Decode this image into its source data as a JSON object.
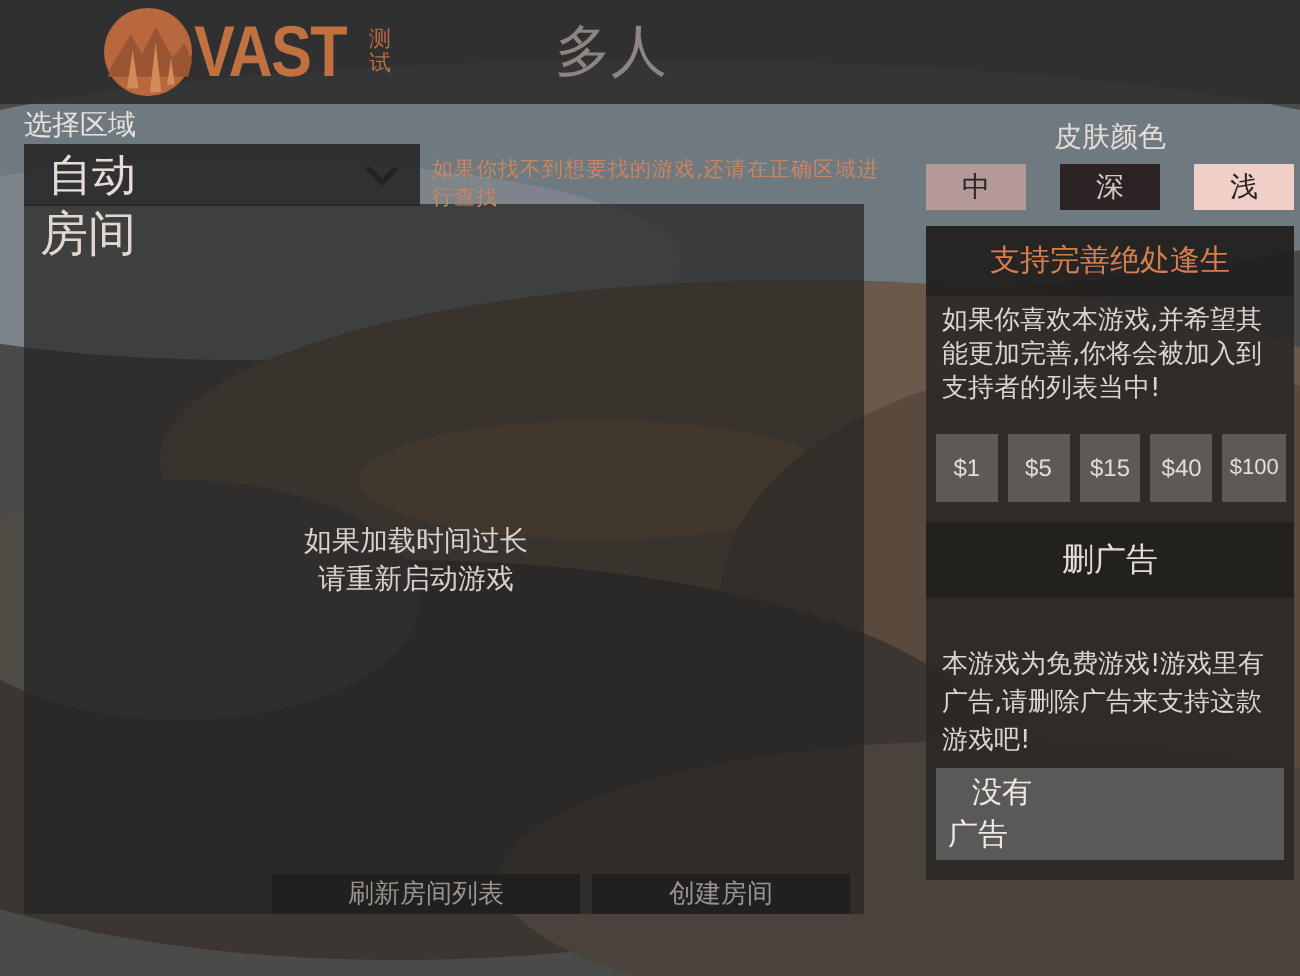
{
  "header": {
    "logo_text": "VAST",
    "logo_tag": "测试",
    "title": "多人"
  },
  "region": {
    "label": "选择区域",
    "value": "自动",
    "hint": "如果你找不到想要找的游戏,还请在正确区域进行查找"
  },
  "rooms": {
    "title": "房间",
    "message": [
      "如果加载时间过长",
      "请重新启动游戏"
    ],
    "buttons": [
      "刷新房间列表",
      "创建房间"
    ]
  },
  "skin": {
    "label": "皮肤颜色",
    "options": [
      {
        "label": "中",
        "color": "#b39a98"
      },
      {
        "label": "深",
        "color": "#2b2324"
      },
      {
        "label": "浅",
        "color": "#f0cfc9"
      }
    ]
  },
  "support": {
    "title": "支持完善绝处逢生",
    "text": "如果你喜欢本游戏,并希望其能更加完善,你将会被加入到支持者的列表当中!",
    "amounts": [
      "$1",
      "$5",
      "$15",
      "$40",
      "$100"
    ],
    "ads_title": "删广告",
    "ads_text": "本游戏为免费游戏!游戏里有广告,请删除广告来支持这款游戏吧!",
    "no_ads_button": [
      "没有",
      "广告"
    ]
  }
}
